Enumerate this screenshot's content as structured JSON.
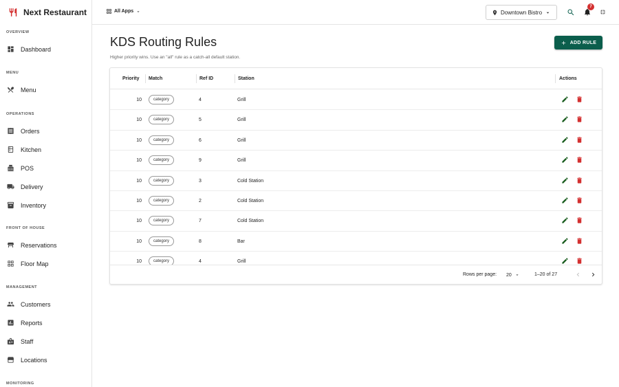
{
  "brand": {
    "name": "Next Restaurant"
  },
  "topbar": {
    "apps_label": "All Apps",
    "location": "Downtown Bistro",
    "notification_count": "7"
  },
  "sidebar": {
    "sections": [
      {
        "title": "OVERVIEW",
        "items": [
          {
            "label": "Dashboard",
            "icon": "dashboard-icon"
          }
        ]
      },
      {
        "title": "MENU",
        "items": [
          {
            "label": "Menu",
            "icon": "utensils-icon"
          }
        ]
      },
      {
        "title": "OPERATIONS",
        "items": [
          {
            "label": "Orders",
            "icon": "receipt-icon"
          },
          {
            "label": "Kitchen",
            "icon": "kitchen-icon"
          },
          {
            "label": "POS",
            "icon": "register-icon"
          },
          {
            "label": "Delivery",
            "icon": "truck-icon"
          },
          {
            "label": "Inventory",
            "icon": "archive-icon"
          }
        ]
      },
      {
        "title": "FRONT OF HOUSE",
        "items": [
          {
            "label": "Reservations",
            "icon": "table-restaurant-icon"
          },
          {
            "label": "Floor Map",
            "icon": "grid-icon"
          }
        ]
      },
      {
        "title": "MANAGEMENT",
        "items": [
          {
            "label": "Customers",
            "icon": "people-icon"
          },
          {
            "label": "Reports",
            "icon": "bar-chart-icon"
          },
          {
            "label": "Staff",
            "icon": "badge-icon"
          },
          {
            "label": "Locations",
            "icon": "storefront-icon"
          }
        ]
      },
      {
        "title": "MONITORING",
        "items": []
      }
    ]
  },
  "page": {
    "title": "KDS Routing Rules",
    "subtitle": "Higher priority wins. Use an \"all\" rule as a catch-all default station.",
    "add_button": "ADD RULE"
  },
  "table": {
    "headers": {
      "priority": "Priority",
      "match": "Match",
      "ref_id": "Ref ID",
      "station": "Station",
      "actions": "Actions"
    },
    "rows": [
      {
        "priority": "10",
        "match": "category",
        "ref_id": "4",
        "station": "Grill"
      },
      {
        "priority": "10",
        "match": "category",
        "ref_id": "5",
        "station": "Grill"
      },
      {
        "priority": "10",
        "match": "category",
        "ref_id": "6",
        "station": "Grill"
      },
      {
        "priority": "10",
        "match": "category",
        "ref_id": "9",
        "station": "Grill"
      },
      {
        "priority": "10",
        "match": "category",
        "ref_id": "3",
        "station": "Cold Station"
      },
      {
        "priority": "10",
        "match": "category",
        "ref_id": "2",
        "station": "Cold Station"
      },
      {
        "priority": "10",
        "match": "category",
        "ref_id": "7",
        "station": "Cold Station"
      },
      {
        "priority": "10",
        "match": "category",
        "ref_id": "8",
        "station": "Bar"
      },
      {
        "priority": "10",
        "match": "category",
        "ref_id": "4",
        "station": "Grill"
      }
    ]
  },
  "pagination": {
    "rows_label": "Rows per page:",
    "rows_value": "20",
    "range": "1–20 of 27"
  },
  "colors": {
    "accent": "#0b5e4c",
    "brand_red": "#d32f2f",
    "edit_green": "#1b5e20",
    "delete_red": "#d32f2f"
  }
}
